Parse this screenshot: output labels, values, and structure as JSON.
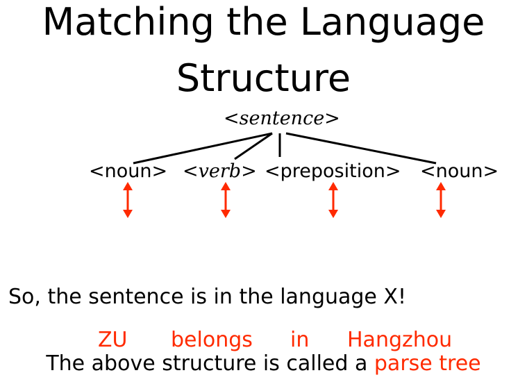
{
  "title": {
    "line1": "Matching the Language",
    "line2": "Structure"
  },
  "tree": {
    "root": "<sentence>",
    "leaves": [
      {
        "label": "<noun>"
      },
      {
        "label": "<verb>"
      },
      {
        "label": "<preposition>"
      },
      {
        "label": "<noun>"
      }
    ]
  },
  "conclusion": "So, the sentence is in the language X!",
  "example_words": [
    "ZU",
    "belongs",
    "in",
    "Hangzhou"
  ],
  "caption": {
    "prefix": "The above structure is called a ",
    "highlight": "parse tree"
  },
  "colors": {
    "accent": "#ff2a00",
    "text": "#000000"
  }
}
